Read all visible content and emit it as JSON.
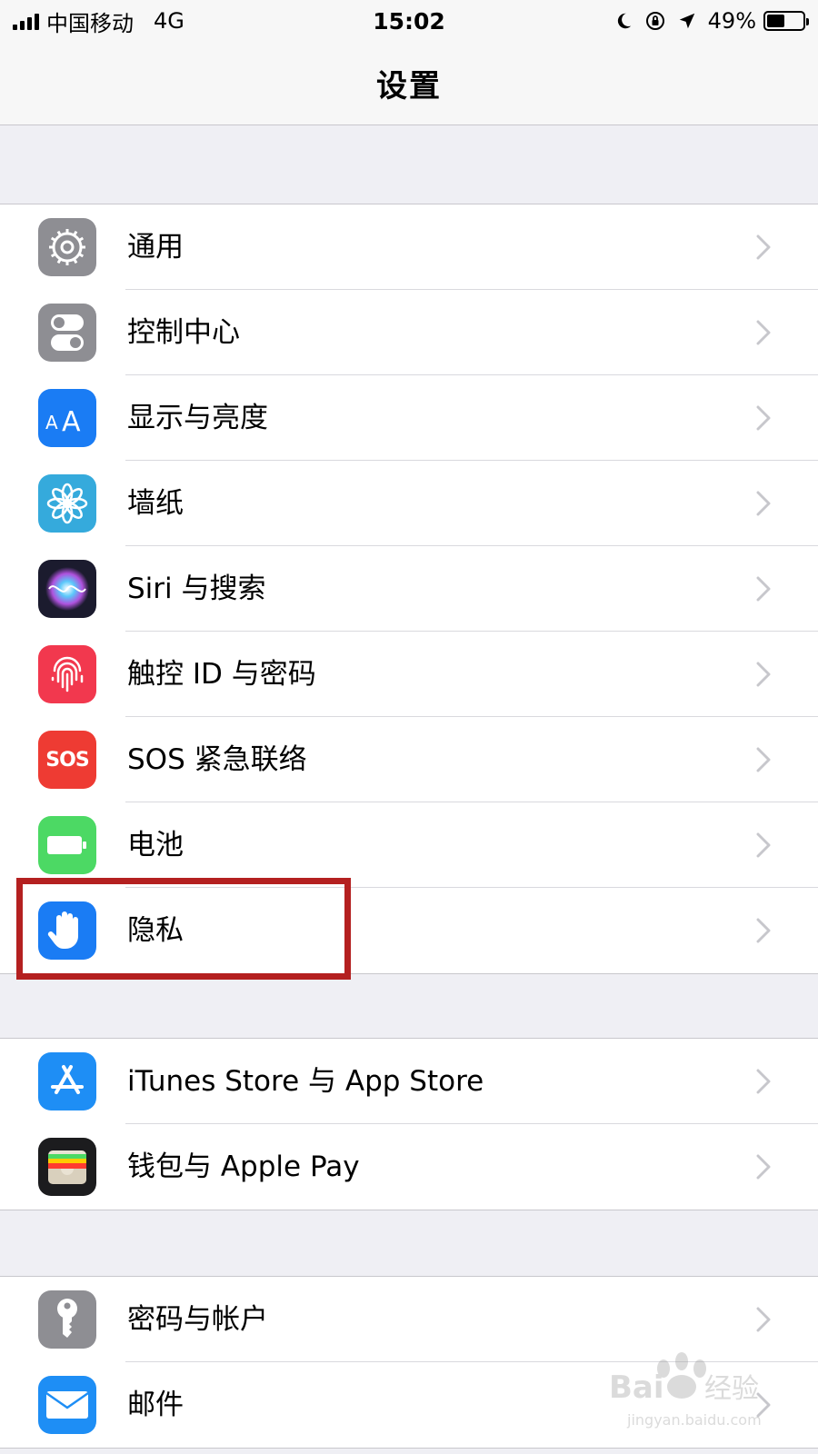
{
  "status_bar": {
    "carrier": "中国移动",
    "network": "4G",
    "time": "15:02",
    "battery_percent": "49%",
    "battery_level": 0.49
  },
  "nav": {
    "title": "设置"
  },
  "groups": [
    {
      "items": [
        {
          "label": "通用",
          "icon": "gear-icon",
          "color": "#8e8e93"
        },
        {
          "label": "控制中心",
          "icon": "toggle-icon",
          "color": "#8e8e93"
        },
        {
          "label": "显示与亮度",
          "icon": "text-size-icon",
          "color": "#1a7cf4"
        },
        {
          "label": "墙纸",
          "icon": "flower-icon",
          "color": "#35aadc"
        },
        {
          "label": "Siri 与搜索",
          "icon": "siri-icon",
          "color": "#1b1b2e"
        },
        {
          "label": "触控 ID 与密码",
          "icon": "fingerprint-icon",
          "color": "#f2384e"
        },
        {
          "label": "SOS 紧急联络",
          "icon": "sos-icon",
          "icon_text": "SOS",
          "color": "#ee3b33"
        },
        {
          "label": "电池",
          "icon": "battery-icon",
          "color": "#4cd964"
        },
        {
          "label": "隐私",
          "icon": "hand-icon",
          "color": "#1a7cf4"
        }
      ]
    },
    {
      "items": [
        {
          "label": "iTunes Store 与 App Store",
          "icon": "app-store-icon",
          "color": "#1e8ef5"
        },
        {
          "label": "钱包与 Apple Pay",
          "icon": "wallet-icon",
          "color": "#1c1c1e"
        }
      ]
    },
    {
      "items": [
        {
          "label": "密码与帐户",
          "icon": "key-icon",
          "color": "#8e8e93"
        },
        {
          "label": "邮件",
          "icon": "mail-icon",
          "color": "#1e8ef5"
        }
      ]
    }
  ],
  "accent_colors": {
    "highlight": "#b42020",
    "chevron": "#c7c7cc"
  }
}
